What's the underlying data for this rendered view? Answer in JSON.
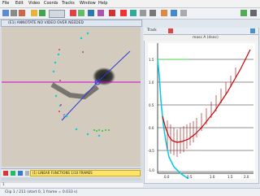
{
  "app": {
    "menu": [
      "File",
      "Edit",
      "Video",
      "Coords",
      "Tracks",
      "Window",
      "Help"
    ]
  },
  "video_panel": {
    "title": "(E1) ANNOTATE NO VIDEO OVER NEEDED",
    "step_info": "(1) LINEAR FUNCTIONS 1/10 FRAMES",
    "frame_label": "1"
  },
  "plot_panel": {
    "tab_label": "Track",
    "title": "mass A (dsec)",
    "x_ticks": [
      "0.0",
      "0.5",
      "1.0",
      "1.5",
      "2.0"
    ],
    "y_ticks": [
      "1.5",
      "1.0",
      "0.5",
      "0.0",
      "-0.5",
      "-1.0"
    ]
  },
  "status": {
    "text": "Clip 1 / 211 (start 0, 1 frame = 0.033 s)"
  },
  "colors": {
    "axis_line": "#d000d0",
    "track_blue": "#2a3dd6",
    "cyan_points": "#00d0e0",
    "green_points": "#32c832",
    "red_data": "#d00000",
    "fit_cyan": "#00c8e8"
  }
}
